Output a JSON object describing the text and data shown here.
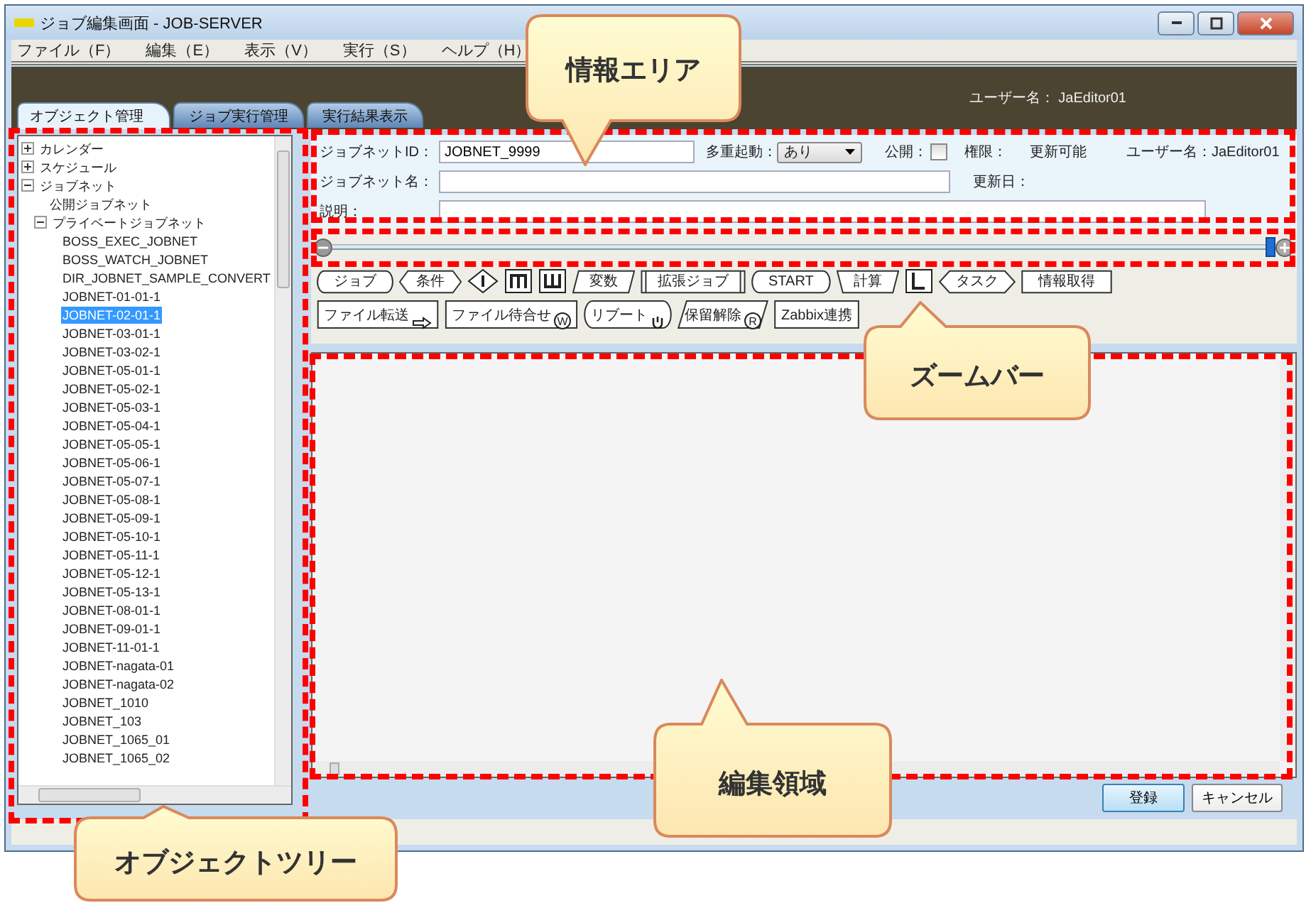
{
  "window": {
    "title": "ジョブ編集画面 - JOB-SERVER"
  },
  "menu": [
    "ファイル（F）",
    "編集（E）",
    "表示（V）",
    "実行（S）",
    "ヘルプ（H）"
  ],
  "header": {
    "user": "ユーザー名： JaEditor01"
  },
  "tabs": [
    {
      "label": "オブジェクト管理",
      "selected": true
    },
    {
      "label": "ジョブ実行管理",
      "selected": false
    },
    {
      "label": "実行結果表示",
      "selected": false
    }
  ],
  "tree": [
    {
      "label": "カレンダー",
      "expanded": false
    },
    {
      "label": "スケジュール",
      "expanded": false
    },
    {
      "label": "ジョブネット",
      "expanded": true,
      "children": [
        {
          "label": "公開ジョブネット"
        },
        {
          "label": "プライベートジョブネット",
          "expanded": true,
          "children": [
            {
              "label": "BOSS_EXEC_JOBNET",
              "selected": false
            },
            {
              "label": "BOSS_WATCH_JOBNET",
              "selected": false
            },
            {
              "label": "DIR_JOBNET_SAMPLE_CONVERT",
              "selected": false
            },
            {
              "label": "JOBNET-01-01-1",
              "selected": false
            },
            {
              "label": "JOBNET-02-01-1",
              "selected": true
            },
            {
              "label": "JOBNET-03-01-1",
              "selected": false
            },
            {
              "label": "JOBNET-03-02-1",
              "selected": false
            },
            {
              "label": "JOBNET-05-01-1",
              "selected": false
            },
            {
              "label": "JOBNET-05-02-1",
              "selected": false
            },
            {
              "label": "JOBNET-05-03-1",
              "selected": false
            },
            {
              "label": "JOBNET-05-04-1",
              "selected": false
            },
            {
              "label": "JOBNET-05-05-1",
              "selected": false
            },
            {
              "label": "JOBNET-05-06-1",
              "selected": false
            },
            {
              "label": "JOBNET-05-07-1",
              "selected": false
            },
            {
              "label": "JOBNET-05-08-1",
              "selected": false
            },
            {
              "label": "JOBNET-05-09-1",
              "selected": false
            },
            {
              "label": "JOBNET-05-10-1",
              "selected": false
            },
            {
              "label": "JOBNET-05-11-1",
              "selected": false
            },
            {
              "label": "JOBNET-05-12-1",
              "selected": false
            },
            {
              "label": "JOBNET-05-13-1",
              "selected": false
            },
            {
              "label": "JOBNET-08-01-1",
              "selected": false
            },
            {
              "label": "JOBNET-09-01-1",
              "selected": false
            },
            {
              "label": "JOBNET-11-01-1",
              "selected": false
            },
            {
              "label": "JOBNET-nagata-01",
              "selected": false
            },
            {
              "label": "JOBNET-nagata-02",
              "selected": false
            },
            {
              "label": "JOBNET_1010",
              "selected": false
            },
            {
              "label": "JOBNET_103",
              "selected": false
            },
            {
              "label": "JOBNET_1065_01",
              "selected": false
            },
            {
              "label": "JOBNET_1065_02",
              "selected": false
            }
          ]
        }
      ]
    }
  ],
  "info": {
    "id_label": "ジョブネットID：",
    "id_value": "JOBNET_9999",
    "multi_label": "多重起動：",
    "multi_value": "あり",
    "public_label": "公開：",
    "public_checked": false,
    "perm_label": "権限：",
    "perm_value": "更新可能",
    "user_label": "ユーザー名：",
    "user_value": "JaEditor01",
    "name_label": "ジョブネット名：",
    "updated_label": "更新日：",
    "desc_label": "説明："
  },
  "zoom": {
    "level": 1
  },
  "toolbar_rows": [
    [
      {
        "kind": "rounded",
        "label": "ジョブ"
      },
      {
        "kind": "hexagon",
        "label": "条件"
      },
      {
        "kind": "diamond"
      },
      {
        "kind": "m-box"
      },
      {
        "kind": "w-box"
      },
      {
        "kind": "slant",
        "label": "変数"
      },
      {
        "kind": "framed",
        "label": "拡張ジョブ"
      },
      {
        "kind": "rounded",
        "label": "START"
      },
      {
        "kind": "trapezoid",
        "label": "計算"
      },
      {
        "kind": "l-box"
      },
      {
        "kind": "hexagon",
        "label": "タスク"
      },
      {
        "kind": "rect",
        "label": "情報取得"
      }
    ],
    [
      {
        "kind": "rect",
        "label": "ファイル転送",
        "badge": {
          "kind": "arrow"
        }
      },
      {
        "kind": "rect",
        "label": "ファイル待合せ",
        "badge": {
          "kind": "letter",
          "text": "W"
        }
      },
      {
        "kind": "rounded",
        "label": "リブート",
        "badge": {
          "kind": "power"
        }
      },
      {
        "kind": "slant",
        "label": "保留解除",
        "badge": {
          "kind": "letter",
          "text": "R"
        }
      },
      {
        "kind": "rect",
        "label": "Zabbix連携"
      }
    ]
  ],
  "buttons": [
    {
      "label": "登録",
      "kind": "primary"
    },
    {
      "label": "キャンセル",
      "kind": "normal"
    }
  ],
  "callouts": [
    {
      "text": "情報エリア",
      "kind": "pointer-down"
    },
    {
      "text": "ズームバー",
      "kind": "pointer-up"
    },
    {
      "text": "編集領域",
      "kind": "pointer-up"
    },
    {
      "text": "オブジェクトツリー",
      "kind": "pointer-up"
    }
  ]
}
